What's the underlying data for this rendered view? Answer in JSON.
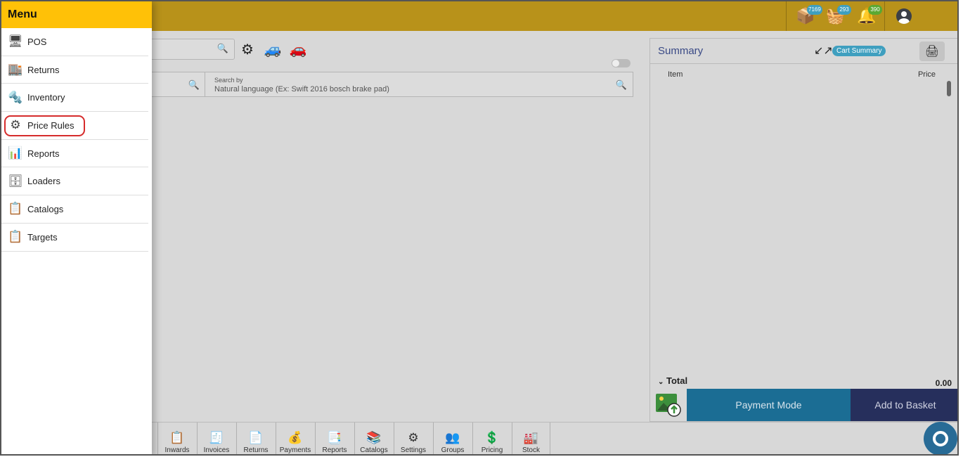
{
  "topbar": {
    "icons": [
      {
        "name": "package-icon",
        "glyph": "📦",
        "badge": "7169",
        "badge_color": "#3f9fbf"
      },
      {
        "name": "basket-icon",
        "glyph": "🧺",
        "badge": "293",
        "badge_color": "#3f9fbf"
      },
      {
        "name": "bell-icon",
        "glyph": "🔔",
        "badge": "390",
        "badge_color": "#5aa832"
      }
    ]
  },
  "menu": {
    "title": "Menu",
    "items": [
      {
        "label": "POS",
        "icon": "pos-terminal-icon",
        "glyph": "🖥"
      },
      {
        "label": "Returns",
        "icon": "returns-box-icon",
        "glyph": "🏬"
      },
      {
        "label": "Inventory",
        "icon": "inventory-parts-icon",
        "glyph": "🔩"
      },
      {
        "label": "Price Rules",
        "icon": "price-gear-icon",
        "glyph": "⚙"
      },
      {
        "label": "Reports",
        "icon": "reports-chart-icon",
        "glyph": "📊"
      },
      {
        "label": "Loaders",
        "icon": "loaders-database-icon",
        "glyph": "🗄"
      },
      {
        "label": "Catalogs",
        "icon": "catalog-book-icon",
        "glyph": "📋"
      },
      {
        "label": "Targets",
        "icon": "targets-book-icon",
        "glyph": "📋"
      }
    ]
  },
  "search": {
    "label": "Search by",
    "placeholder": "Natural language (Ex: Swift 2016 bosch brake pad)"
  },
  "vehicle_icons": [
    {
      "name": "brake-disc-icon",
      "glyph": "⚙"
    },
    {
      "name": "service-garage-icon",
      "glyph": "🚙"
    },
    {
      "name": "car-icon",
      "glyph": "🚗"
    }
  ],
  "summary": {
    "title": "Summary",
    "cart_badge": "Cart Summary",
    "col_item": "Item",
    "col_price": "Price",
    "total_label": "Total",
    "total_value": "0.00",
    "payment_button": "Payment Mode",
    "basket_button": "Add to Basket"
  },
  "bottom_nav": [
    {
      "label": "Inwards",
      "icon": "inwards-clipboard-icon",
      "glyph": "📋"
    },
    {
      "label": "Invoices",
      "icon": "invoices-doc-icon",
      "glyph": "🧾"
    },
    {
      "label": "Returns",
      "icon": "returns-doc-icon",
      "glyph": "📄"
    },
    {
      "label": "Payments",
      "icon": "payments-hand-icon",
      "glyph": "💰"
    },
    {
      "label": "Reports",
      "icon": "reports-doc-icon",
      "glyph": "📑"
    },
    {
      "label": "Catalogs",
      "icon": "catalogs-book-icon",
      "glyph": "📚"
    },
    {
      "label": "Settings",
      "icon": "settings-gear-icon",
      "glyph": "⚙"
    },
    {
      "label": "Groups",
      "icon": "groups-people-icon",
      "glyph": "👥"
    },
    {
      "label": "Pricing",
      "icon": "pricing-tag-icon",
      "glyph": "💲"
    },
    {
      "label": "Stock",
      "icon": "stock-warehouse-icon",
      "glyph": "🏭"
    }
  ]
}
